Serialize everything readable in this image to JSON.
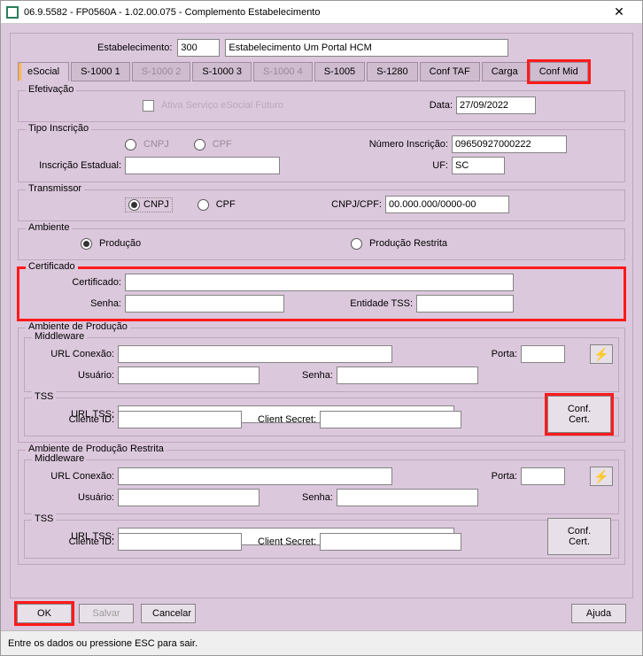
{
  "window": {
    "title": "06.9.5582 - FP0560A - 1.02.00.075 - Complemento Estabelecimento"
  },
  "header": {
    "estab_label": "Estabelecimento:",
    "estab_code": "300",
    "estab_name": "Estabelecimento Um Portal HCM"
  },
  "tabs": [
    "eSocial",
    "S-1000 1",
    "S-1000 2",
    "S-1000 3",
    "S-1000 4",
    "S-1005",
    "S-1280",
    "Conf TAF",
    "Carga",
    "Conf Mid"
  ],
  "efetivacao": {
    "legend": "Efetivação",
    "chk_label": "Ativa Serviço eSocial Futuro",
    "data_label": "Data:",
    "data_value": "27/09/2022"
  },
  "tipo": {
    "legend": "Tipo Inscrição",
    "cnpj": "CNPJ",
    "cpf": "CPF",
    "num_label": "Número Inscrição:",
    "num_value": "09650927000222",
    "insc_est_label": "Inscrição Estadual:",
    "insc_est_value": "",
    "uf_label": "UF:",
    "uf_value": "SC"
  },
  "trans": {
    "legend": "Transmissor",
    "cnpj": "CNPJ",
    "cpf": "CPF",
    "doc_label": "CNPJ/CPF:",
    "doc_value": "00.000.000/0000-00"
  },
  "amb": {
    "legend": "Ambiente",
    "prod": "Produção",
    "rest": "Produção Restrita"
  },
  "cert": {
    "legend": "Certificado",
    "cert_label": "Certificado:",
    "cert_value": "",
    "senha_label": "Senha:",
    "senha_value": "",
    "entidade_label": "Entidade TSS:",
    "entidade_value": ""
  },
  "env": {
    "prod_legend": "Ambiente de Produção",
    "rest_legend": "Ambiente de Produção Restrita",
    "mw_legend": "Middleware",
    "tss_legend": "TSS",
    "url_conexao": "URL Conexão:",
    "usuario": "Usuário:",
    "senha": "Senha:",
    "porta": "Porta:",
    "url_tss": "URL TSS:",
    "cliente_id": "Cliente ID:",
    "client_secret": "Client Secret:",
    "conf_cert": "Conf. Cert."
  },
  "buttons": {
    "ok": "OK",
    "salvar": "Salvar",
    "cancelar": "Cancelar",
    "ajuda": "Ajuda"
  },
  "status": "Entre os dados ou pressione ESC para sair."
}
